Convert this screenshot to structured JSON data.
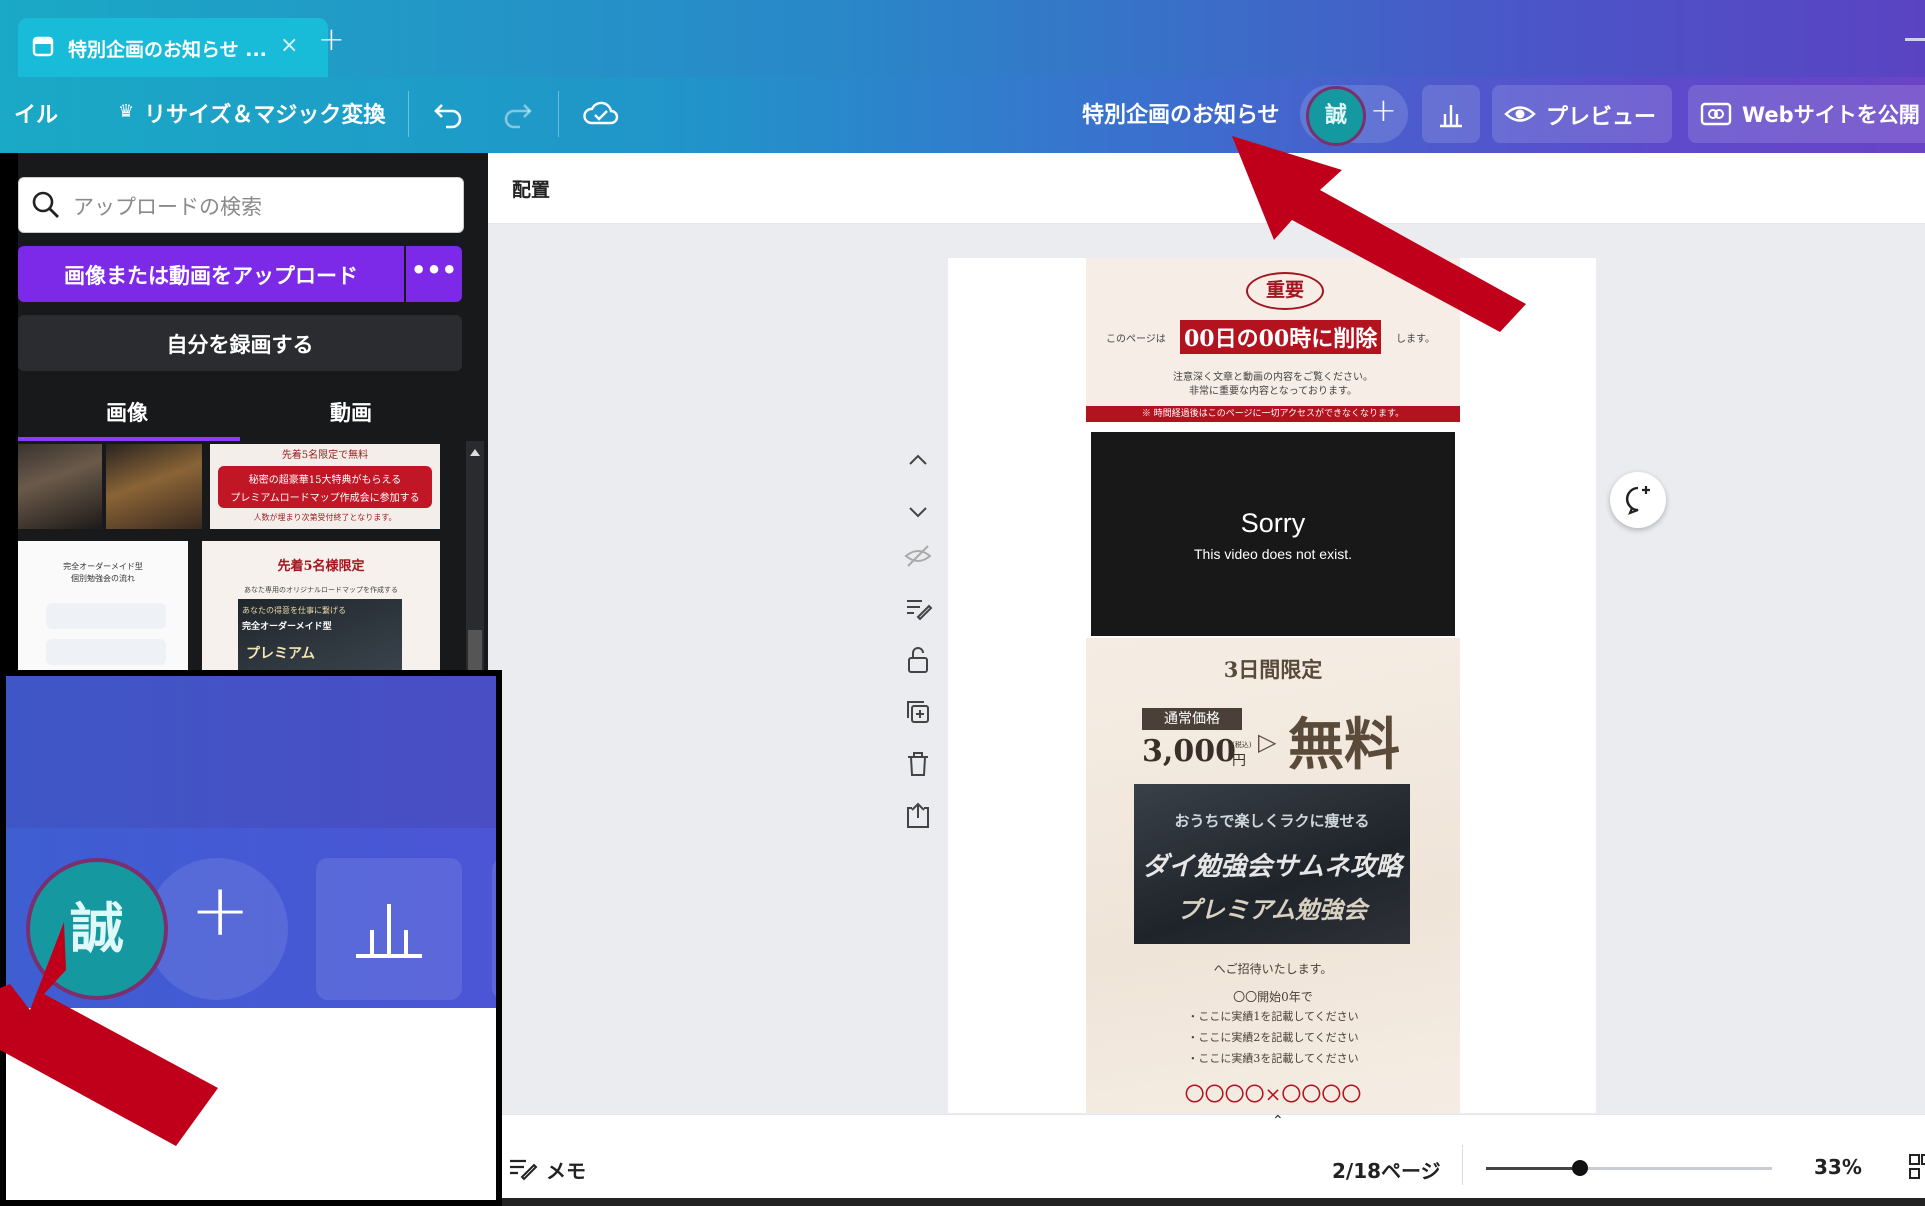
{
  "browser": {
    "tab_title": "特別企画のお知らせ ...",
    "tab_close": "×",
    "new_tab": "+"
  },
  "header": {
    "file_menu": "イル",
    "resize_label": "リサイズ＆マジック変換",
    "design_title": "特別企画のお知らせ",
    "avatar_initial": "誠",
    "add_label": "+",
    "preview_label": "プレビュー",
    "publish_label": "Webサイトを公開"
  },
  "left_panel": {
    "search_placeholder": "アップロードの検索",
    "upload_label": "画像または動画をアップロード",
    "more_label": "•••",
    "record_label": "自分を録画する",
    "tabs": [
      "画像",
      "動画"
    ]
  },
  "thumbnails": {
    "t2_line1": "先着5名限定で無料",
    "t2_line2": "秘密の超豪華15大特典がもらえる",
    "t2_line3": "プレミアムロードマップ作成会に参加する",
    "t2_line4": "人数が埋まり次第受付終了となります。",
    "t3_line1": "完全オーダーメイド型",
    "t3_line2": "個別勉強会の流れ",
    "t4_line1": "先着5名様限定",
    "t4_line2": "あなた専用のオリジナルロードマップを作成する",
    "t4_line3": "あなたの得意を仕事に繋げる",
    "t4_line4": "完全オーダーメイド型",
    "t4_line5": "プレミアム"
  },
  "toolbar": {
    "position_label": "配置"
  },
  "page": {
    "badge": "重要",
    "line_pre": "このページは",
    "line_highlight": "00日の00時に削除",
    "line_post": "します。",
    "note1": "注意深く文章と動画の内容をご覧ください。",
    "note2": "非常に重要な内容となっております。",
    "warning_bar": "※ 時間経過後はこのページに一切アクセスができなくなります。",
    "video_title": "Sorry",
    "video_sub": "This video does not exist.",
    "limited": "3日間限定",
    "price_label": "通常価格",
    "price": "3,000",
    "price_tax": "(税込)",
    "price_unit": "円",
    "free": "無料",
    "promo1": "おうちで楽しくラクに痩せる",
    "promo2": "ダイ勉強会サムネ攻略",
    "promo3": "プレミアム勉強会",
    "invite": "へご招待いたします。",
    "start": "〇〇開始0年で",
    "bullet1": "・ここに実績1を記載してください",
    "bullet2": "・ここに実績2を記載してください",
    "bullet3": "・ここに実績3を記載してください",
    "collab": "〇〇〇〇×〇〇〇〇"
  },
  "footer": {
    "notes_label": "メモ",
    "page_indicator": "2/18ページ",
    "zoom": "33%",
    "zoom_level": 0.33
  },
  "zoom_callout": {
    "avatar_initial": "誠",
    "add_label": "+"
  },
  "colors": {
    "arrow": "#c0001a",
    "upload_purple": "#7d2ae8",
    "avatar_teal": "#1598a0",
    "warning_red": "#b3121f"
  }
}
